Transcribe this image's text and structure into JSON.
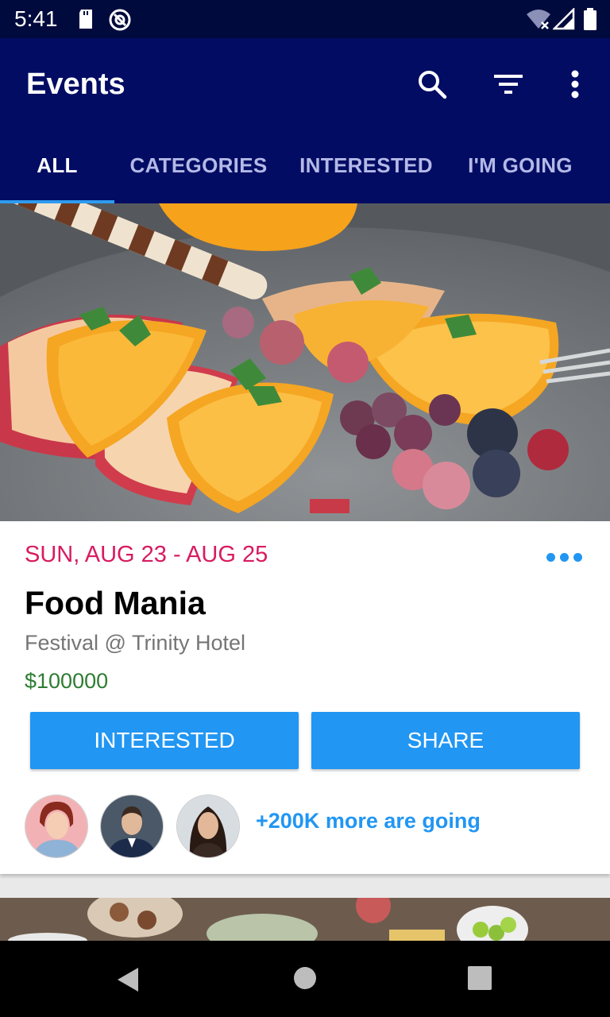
{
  "status_bar": {
    "time": "5:41",
    "icons": [
      "sd-card-icon",
      "vpn-icon",
      "wifi-icon",
      "signal-icon",
      "battery-icon"
    ]
  },
  "app_bar": {
    "title": "Events",
    "actions": [
      "search-icon",
      "filter-icon",
      "more-vert-icon"
    ]
  },
  "tabs": [
    {
      "label": "ALL",
      "active": true
    },
    {
      "label": "CATEGORIES",
      "active": false
    },
    {
      "label": "INTERESTED",
      "active": false
    },
    {
      "label": "I'M GOING",
      "active": false
    }
  ],
  "event": {
    "date": "SUN, AUG 23 - AUG 25",
    "title": "Food Mania",
    "subtitle": "Festival @ Trinity Hotel",
    "price": "$100000",
    "interested_label": "INTERESTED",
    "share_label": "SHARE",
    "going_text": "+200K more are going"
  },
  "colors": {
    "status_bar": "#000a3c",
    "app_bar": "#020c63",
    "accent": "#2196f3",
    "date": "#d81b60",
    "price": "#2e7d32"
  }
}
